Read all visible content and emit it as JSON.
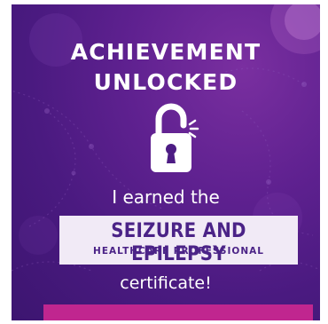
{
  "headline": {
    "line1": "ACHIEVEMENT",
    "line2": "UNLOCKED"
  },
  "icon": "unlocked-padlock-icon",
  "earned_text": "I earned the",
  "certificate": {
    "title": "SEIZURE AND EPILEPSY",
    "subtitle": "HEALTHCARE PROFESSIONAL"
  },
  "closing_text": "certificate!",
  "colors": {
    "background": "#5a1f8c",
    "box_bg": "#f1eaf6",
    "box_text": "#4b2387",
    "accent_bar": "#c0268f"
  }
}
